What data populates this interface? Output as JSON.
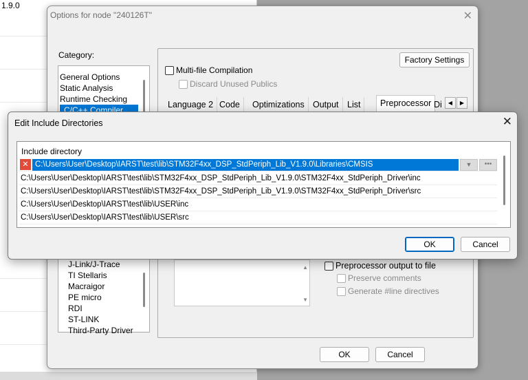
{
  "background": {
    "version_text": "1.9.0"
  },
  "options": {
    "title": "Options for node \"240126T\"",
    "category_label": "Category:",
    "categories_top": [
      "General Options",
      "Static Analysis",
      "Runtime Checking",
      "C/C++ Compiler"
    ],
    "categories_bottom": [
      "J-Link/J-Trace",
      "TI Stellaris",
      "Macraigor",
      "PE micro",
      "RDI",
      "ST-LINK",
      "Third-Party Driver"
    ],
    "factory_settings": "Factory Settings",
    "multi_file": "Multi-file Compilation",
    "discard_unused": "Discard Unused Publics",
    "tabs": [
      "Language 2",
      "Code",
      "Optimizations",
      "Output",
      "List",
      "Preprocessor",
      "Di"
    ],
    "pp_output": "Preprocessor output to file",
    "preserve_comments": "Preserve comments",
    "generate_line": "Generate #line directives",
    "ok": "OK",
    "cancel": "Cancel"
  },
  "include_dialog": {
    "title": "Edit Include Directories",
    "header": "Include directory",
    "rows": [
      "C:\\Users\\User\\Desktop\\IARST\\test\\lib\\STM32F4xx_DSP_StdPeriph_Lib_V1.9.0\\Libraries\\CMSIS",
      "C:\\Users\\User\\Desktop\\IARST\\test\\lib\\STM32F4xx_DSP_StdPeriph_Lib_V1.9.0\\STM32F4xx_StdPeriph_Driver\\inc",
      "C:\\Users\\User\\Desktop\\IARST\\test\\lib\\STM32F4xx_DSP_StdPeriph_Lib_V1.9.0\\STM32F4xx_StdPeriph_Driver\\src",
      "C:\\Users\\User\\Desktop\\IARST\\test\\lib\\USER\\inc",
      "C:\\Users\\User\\Desktop\\IARST\\test\\lib\\USER\\src"
    ],
    "ok": "OK",
    "cancel": "Cancel"
  },
  "icons": {
    "close": "close-icon",
    "delete": "delete-icon",
    "dropdown": "chevron-down-icon",
    "browse": "ellipsis-icon"
  },
  "colors": {
    "selection": "#0078d7",
    "delete": "#e04b3a"
  }
}
